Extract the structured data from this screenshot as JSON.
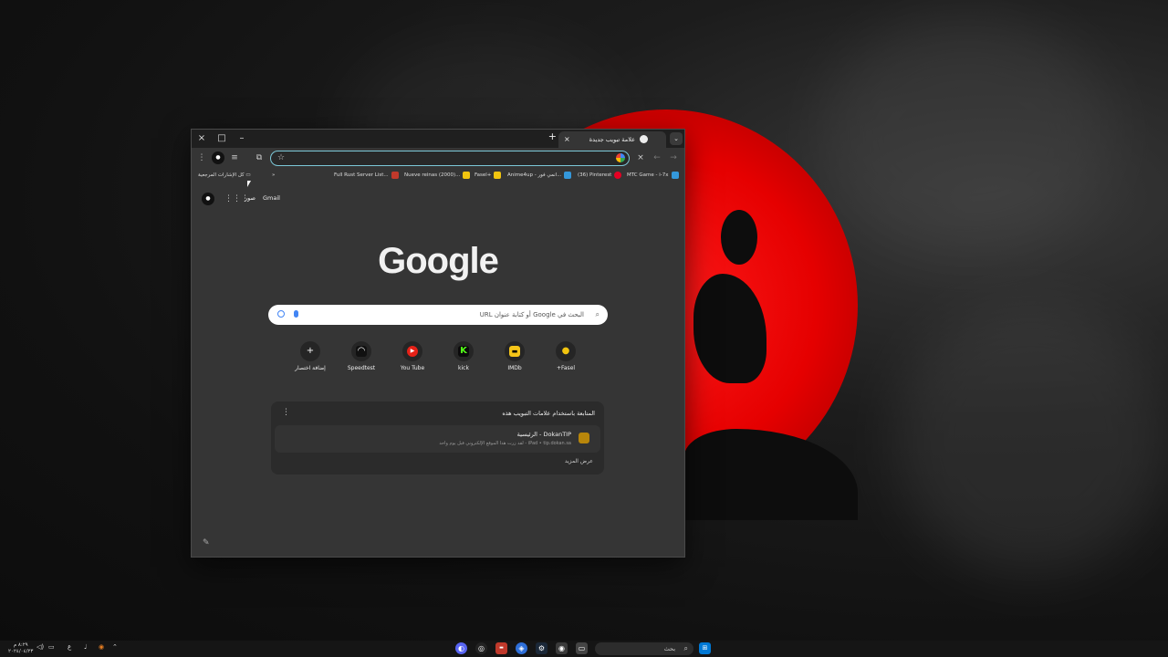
{
  "window": {
    "tab_title": "علامة تبويب جديدة",
    "new_tab": "+",
    "close": "×",
    "maximize": "□",
    "minimize": "–"
  },
  "toolbar": {
    "omnibox_value": "",
    "icons": [
      "menu-icon",
      "profile-icon",
      "extensions-icon",
      "sidebar-icon",
      "close-icon",
      "back-icon",
      "forward-icon"
    ]
  },
  "bookmarks": {
    "all_bookmarks": "كل الإشارات المرجعية",
    "more": "»",
    "items": [
      {
        "label": "Full Rust Server List...",
        "color": "#c0392b"
      },
      {
        "label": "Nueve reinas (2000)...",
        "color": "#f1c40f"
      },
      {
        "label": "Fasel+",
        "color": "#f1c40f"
      },
      {
        "label": "Anime4up - انمي فور...",
        "color": "#3498db"
      },
      {
        "label": "(36) Pinterest",
        "color": "#e60023"
      },
      {
        "label": "MTC Game - i-7x",
        "color": "#3498db"
      }
    ]
  },
  "ntp": {
    "gmail": "Gmail",
    "images": "صور",
    "logo": "Google",
    "search_placeholder": "البحث في Google أو كتابة عنوان URL",
    "shortcuts": [
      {
        "label": "إضافة اختصار",
        "icon": "+",
        "color": "#252525"
      },
      {
        "label": "Speedtest",
        "icon": "◠",
        "color": "#111111"
      },
      {
        "label": "You Tube",
        "icon": "▶",
        "color": "#e62117"
      },
      {
        "label": "kick",
        "icon": "K",
        "color": "#53fc18"
      },
      {
        "label": "IMDb",
        "icon": "▬",
        "color": "#f5c518"
      },
      {
        "label": "Fasel+",
        "icon": "●",
        "color": "#f1c40f"
      }
    ],
    "card": {
      "heading": "المتابعة باستخدام علامات التبويب هذه",
      "item_title": "DokanTIP - الرئيسية",
      "item_sub": "iPad • tip.dokan.sa - لقد زرت هذا الموقع الإلكتروني قبل يوم واحد",
      "more": "عرض المزيد"
    }
  },
  "taskbar": {
    "search_label": "بحث",
    "time": "٨:٢٩ م",
    "date": "٢٠٢٤/٠٤/٢٣",
    "lang": "ع"
  }
}
